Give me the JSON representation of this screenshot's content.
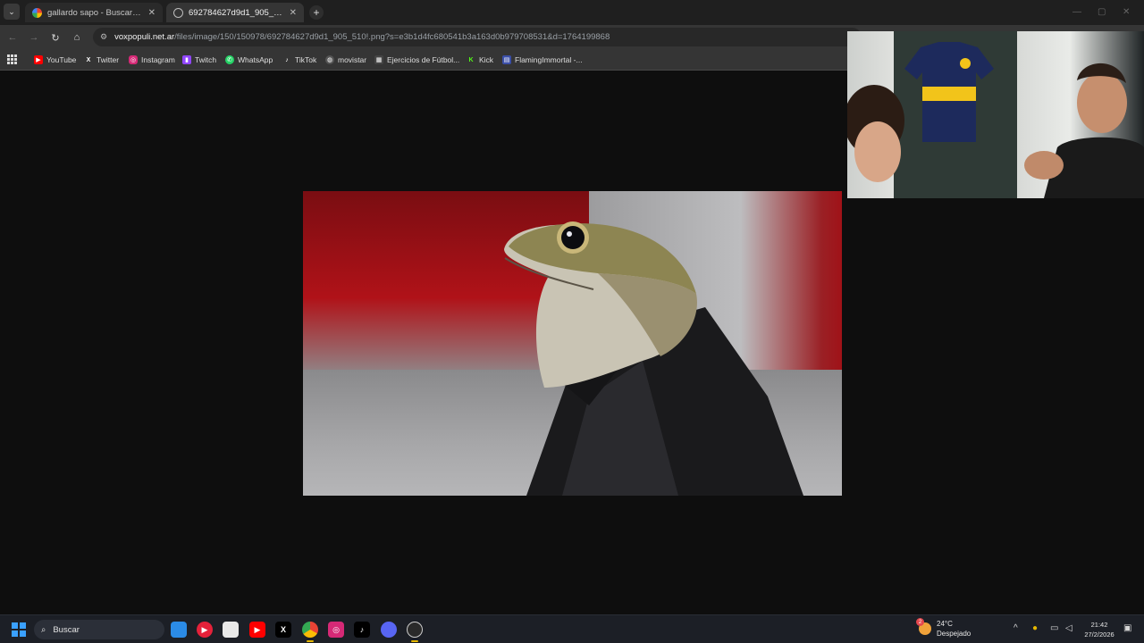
{
  "browser": {
    "tabs": [
      {
        "title": "gallardo sapo - Buscar con Go...",
        "active": false
      },
      {
        "title": "692784627d9d1_905_510!.png",
        "active": true
      }
    ],
    "new_tab_symbol": "+",
    "close_symbol": "✕",
    "address": {
      "host": "voxpopuli.net.ar",
      "path": "/files/image/150/150978/692784627d9d1_905_510!.png?s=e3b1d4fc680541b3a163d0b979708531&d=1764199868"
    },
    "bookmarks": [
      {
        "label": "YouTube",
        "icon": "youtube-icon",
        "color": "#ff0000"
      },
      {
        "label": "Twitter",
        "icon": "x-icon",
        "color": "#000000"
      },
      {
        "label": "Instagram",
        "icon": "instagram-icon",
        "color": "#d62976"
      },
      {
        "label": "Twitch",
        "icon": "twitch-icon",
        "color": "#9146ff"
      },
      {
        "label": "WhatsApp",
        "icon": "whatsapp-icon",
        "color": "#25d366"
      },
      {
        "label": "TikTok",
        "icon": "tiktok-icon",
        "color": "#111111"
      },
      {
        "label": "movistar",
        "icon": "globe-icon",
        "color": "#555555"
      },
      {
        "label": "Ejercicios de Fútbol...",
        "icon": "grid-icon",
        "color": "#444444"
      },
      {
        "label": "Kick",
        "icon": "kick-icon",
        "color": "#53fc18"
      },
      {
        "label": "FlamingImmortal -...",
        "icon": "folder-icon",
        "color": "#3b4fa8"
      }
    ]
  },
  "content": {
    "image_description_icon": "frog-in-suit-image"
  },
  "webcam": {
    "icon": "webcam-overlay"
  },
  "taskbar": {
    "search_placeholder": "Buscar",
    "apps": [
      {
        "icon": "file-explorer-icon",
        "color": "#2b8be6",
        "glyph": ""
      },
      {
        "icon": "media-player-icon",
        "color": "#e5213a",
        "glyph": "▶"
      },
      {
        "icon": "microsoft-store-icon",
        "color": "#e9e9e9",
        "glyph": ""
      },
      {
        "icon": "youtube-icon",
        "color": "#ff0000",
        "glyph": "▶"
      },
      {
        "icon": "x-icon",
        "color": "#000000",
        "glyph": "X"
      },
      {
        "icon": "chrome-icon",
        "color": "#4a8af4",
        "glyph": ""
      },
      {
        "icon": "instagram-icon",
        "color": "#d62976",
        "glyph": ""
      },
      {
        "icon": "tiktok-icon",
        "color": "#000000",
        "glyph": "♪"
      },
      {
        "icon": "discord-icon",
        "color": "#5865f2",
        "glyph": ""
      },
      {
        "icon": "obs-icon",
        "color": "#2a2a2a",
        "glyph": ""
      }
    ],
    "weather": {
      "temp": "24°C",
      "condition": "Despejado",
      "badge": "2"
    },
    "clock": {
      "time": "21:42",
      "date": "27/2/2026"
    }
  },
  "colors": {
    "accent_blue": "#3aa0ff",
    "tab_bg": "#353535",
    "page_bg": "#0e0e0e"
  }
}
